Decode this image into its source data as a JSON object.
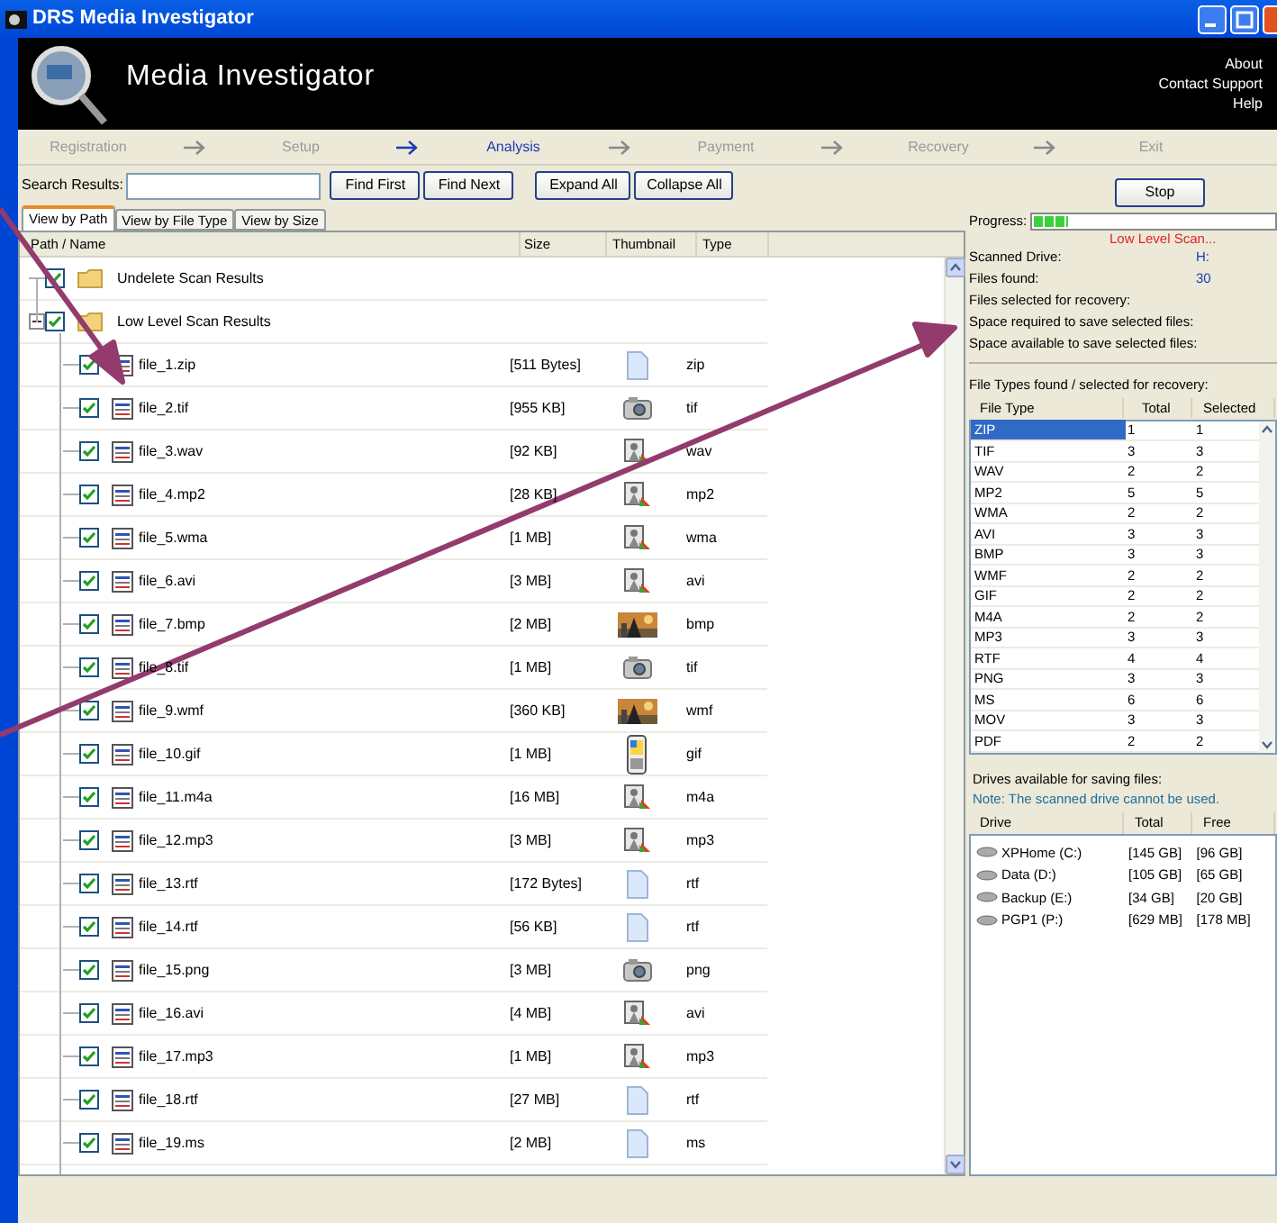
{
  "window": {
    "title": "DRS Media Investigator"
  },
  "header": {
    "title": "Media Investigator",
    "links": [
      "About",
      "Contact Support",
      "Help"
    ]
  },
  "steps": [
    {
      "label": "Registration",
      "selected": false
    },
    {
      "label": "Setup",
      "selected": false
    },
    {
      "label": "Analysis",
      "selected": true
    },
    {
      "label": "Payment",
      "selected": false
    },
    {
      "label": "Recovery",
      "selected": false
    },
    {
      "label": "Exit",
      "selected": false
    }
  ],
  "search": {
    "label": "Search Results:",
    "buttons": [
      "Find First",
      "Find Next"
    ]
  },
  "tree_buttons": [
    "Expand All",
    "Collapse All"
  ],
  "stop_button": "Stop",
  "view_tabs": [
    {
      "label": "View by Path",
      "selected": true
    },
    {
      "label": "View by File Type",
      "selected": false
    },
    {
      "label": "View by Size",
      "selected": false
    }
  ],
  "tree": {
    "columns": [
      "Path / Name",
      "Size",
      "Thumbnail",
      "Type"
    ],
    "items": [
      {
        "name": "Undelete Scan Results",
        "checked": true
      },
      {
        "name": "Low Level Scan Results",
        "checked": true,
        "expanded": true,
        "children": [
          {
            "name": "file_1.zip",
            "size": "[511 Bytes]",
            "kind": "document",
            "type": "zip",
            "checked": true
          },
          {
            "name": "file_2.tif",
            "size": "[955 KB]",
            "kind": "camera",
            "type": "tif",
            "checked": true
          },
          {
            "name": "file_3.wav",
            "size": "[92 KB]",
            "kind": "media",
            "type": "wav",
            "checked": true
          },
          {
            "name": "file_4.mp2",
            "size": "[28 KB]",
            "kind": "media",
            "type": "mp2",
            "checked": true
          },
          {
            "name": "file_5.wma",
            "size": "[1 MB]",
            "kind": "media",
            "type": "wma",
            "checked": true
          },
          {
            "name": "file_6.avi",
            "size": "[3 MB]",
            "kind": "media",
            "type": "avi",
            "checked": true
          },
          {
            "name": "file_7.bmp",
            "size": "[2 MB]",
            "kind": "picture",
            "type": "bmp",
            "checked": true
          },
          {
            "name": "file_8.tif",
            "size": "[1 MB]",
            "kind": "camera",
            "type": "tif",
            "checked": true
          },
          {
            "name": "file_9.wmf",
            "size": "[360 KB]",
            "kind": "picture",
            "type": "wmf",
            "checked": true
          },
          {
            "name": "file_10.gif",
            "size": "[1 MB]",
            "kind": "device",
            "type": "gif",
            "checked": true
          },
          {
            "name": "file_11.m4a",
            "size": "[16 MB]",
            "kind": "media",
            "type": "m4a",
            "checked": true
          },
          {
            "name": "file_12.mp3",
            "size": "[3 MB]",
            "kind": "media",
            "type": "mp3",
            "checked": true
          },
          {
            "name": "file_13.rtf",
            "size": "[172 Bytes]",
            "kind": "document",
            "type": "rtf",
            "checked": true
          },
          {
            "name": "file_14.rtf",
            "size": "[56 KB]",
            "kind": "document",
            "type": "rtf",
            "checked": true
          },
          {
            "name": "file_15.png",
            "size": "[3 MB]",
            "kind": "camera",
            "type": "png",
            "checked": true
          },
          {
            "name": "file_16.avi",
            "size": "[4 MB]",
            "kind": "media",
            "type": "avi",
            "checked": true
          },
          {
            "name": "file_17.mp3",
            "size": "[1 MB]",
            "kind": "media",
            "type": "mp3",
            "checked": true
          },
          {
            "name": "file_18.rtf",
            "size": "[27 MB]",
            "kind": "document",
            "type": "rtf",
            "checked": true
          },
          {
            "name": "file_19.ms",
            "size": "[2 MB]",
            "kind": "document",
            "type": "ms",
            "checked": true
          }
        ]
      }
    ]
  },
  "progress": {
    "label": "Progress:",
    "level": 0.14,
    "status": "Low Level Scan..."
  },
  "scan_info": [
    {
      "label": "Scanned Drive:",
      "value": "H:"
    },
    {
      "label": "Files found:",
      "value": "30"
    },
    {
      "label": "Files selected for recovery:"
    },
    {
      "label": "Space required to save selected files:"
    },
    {
      "label": "Space available to save selected files:"
    }
  ],
  "file_types": {
    "title": "File Types found / selected for recovery:",
    "columns": [
      "File Type",
      "Total",
      "Selected"
    ],
    "rows": [
      {
        "type": "ZIP",
        "total": "1",
        "count": "1",
        "selected": true
      },
      {
        "type": "TIF",
        "total": "3",
        "count": "3",
        "selected": false
      },
      {
        "type": "WAV",
        "total": "2",
        "count": "2",
        "selected": false
      },
      {
        "type": "MP2",
        "total": "5",
        "count": "5",
        "selected": false
      },
      {
        "type": "WMA",
        "total": "2",
        "count": "2",
        "selected": false
      },
      {
        "type": "AVI",
        "total": "3",
        "count": "3",
        "selected": false
      },
      {
        "type": "BMP",
        "total": "3",
        "count": "3",
        "selected": false
      },
      {
        "type": "WMF",
        "total": "2",
        "count": "2",
        "selected": false
      },
      {
        "type": "GIF",
        "total": "2",
        "count": "2",
        "selected": false
      },
      {
        "type": "M4A",
        "total": "2",
        "count": "2",
        "selected": false
      },
      {
        "type": "MP3",
        "total": "3",
        "count": "3",
        "selected": false
      },
      {
        "type": "RTF",
        "total": "4",
        "count": "4",
        "selected": false
      },
      {
        "type": "PNG",
        "total": "3",
        "count": "3",
        "selected": false
      },
      {
        "type": "MS",
        "total": "6",
        "count": "6",
        "selected": false
      },
      {
        "type": "MOV",
        "total": "3",
        "count": "3",
        "selected": false
      },
      {
        "type": "PDF",
        "total": "2",
        "count": "2",
        "selected": false
      }
    ]
  },
  "drives": {
    "title": "Drives available for saving files:",
    "note": "Note: The scanned drive cannot be used.",
    "columns": [
      "Drive",
      "Total",
      "Free"
    ],
    "rows": [
      {
        "name": "XPHome (C:)",
        "total": "[145 GB]",
        "free": "[96 GB]"
      },
      {
        "name": "Data (D:)",
        "total": "[105 GB]",
        "free": "[65 GB]"
      },
      {
        "name": "Backup (E:)",
        "total": "[34 GB]",
        "free": "[20 GB]"
      },
      {
        "name": "PGP1 (P:)",
        "total": "[629 MB]",
        "free": "[178 MB]"
      }
    ]
  }
}
